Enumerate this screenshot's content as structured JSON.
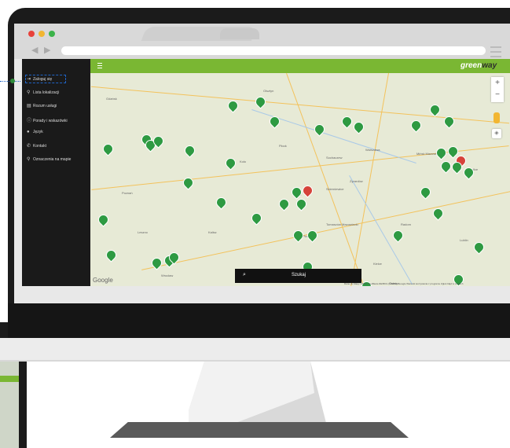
{
  "sidebar": {
    "items": [
      {
        "icon": "login-icon",
        "label": "Zaloguj się"
      },
      {
        "icon": "location-pin-icon",
        "label": "Lista lokalizacji"
      },
      {
        "icon": "document-icon",
        "label": "Rozum usługi"
      },
      {
        "icon": "info-icon",
        "label": "Porady i wskazówki"
      },
      {
        "icon": "globe-icon",
        "label": "Język"
      },
      {
        "icon": "phone-icon",
        "label": "Kontakt"
      },
      {
        "icon": "map-pin-icon",
        "label": "Oznaczenia na mapie"
      }
    ]
  },
  "app": {
    "logo_part1": "green",
    "logo_part2": "way",
    "accent_color": "#7ab733"
  },
  "map": {
    "zoom_in": "+",
    "zoom_out": "−",
    "search_label": "Szukaj",
    "google_label": "Google",
    "attribution": "Dane do Mapy ©2021 GeoBasis-DE/BKG (©2009), Google   Warunki korzystania z programu   Zgłoś błąd w mapach",
    "cities": [
      "Gdańsk",
      "Olsztyn",
      "Płock",
      "Warszawa",
      "Łódź",
      "Piotrków",
      "Radom",
      "Kielce",
      "Lublin",
      "Poznań",
      "Wrocław",
      "Ostrów",
      "Skierniewice",
      "Mińsk Mazowiecki",
      "Siedlce",
      "Tomaszów Mazowiecki",
      "Sochaczew",
      "Koło",
      "Kalisz",
      "Leszno",
      "Żyrardów"
    ]
  },
  "browser": {
    "traffic_lights": [
      "#e8423a",
      "#f2b632",
      "#3cb34a"
    ]
  }
}
